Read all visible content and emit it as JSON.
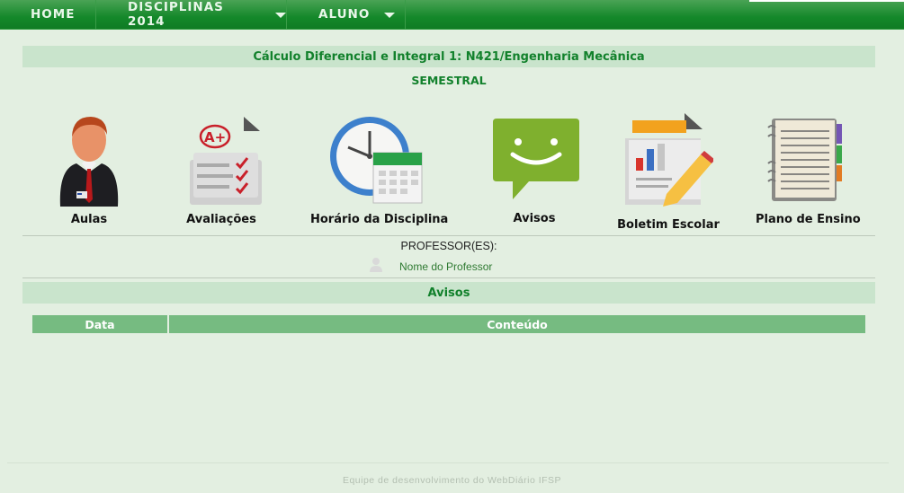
{
  "nav": {
    "home": "HOME",
    "disciplinas": "DISCIPLINAS 2014",
    "aluno": "ALUNO"
  },
  "course": {
    "title": "Cálculo Diferencial e Integral 1: N421/Engenharia Mecânica",
    "period": "SEMESTRAL"
  },
  "tiles": {
    "aulas": "Aulas",
    "avaliacoes": "Avaliações",
    "horario": "Horário da Disciplina",
    "avisos": "Avisos",
    "boletim": "Boletim Escolar",
    "plano": "Plano de Ensino"
  },
  "professor": {
    "heading": "PROFESSOR(ES):",
    "name": "Nome do Professor"
  },
  "avisos_section": {
    "title": "Avisos",
    "columns": [
      "Data",
      "Conteúdo"
    ],
    "rows": []
  },
  "footer": "Equipe de desenvolvimento do WebDiário IFSP",
  "colors": {
    "nav_green": "#14882a",
    "page_bg": "#e3efe1",
    "section_bar": "#c9e4cc",
    "title_text": "#12812c",
    "table_header": "#76bb81"
  }
}
